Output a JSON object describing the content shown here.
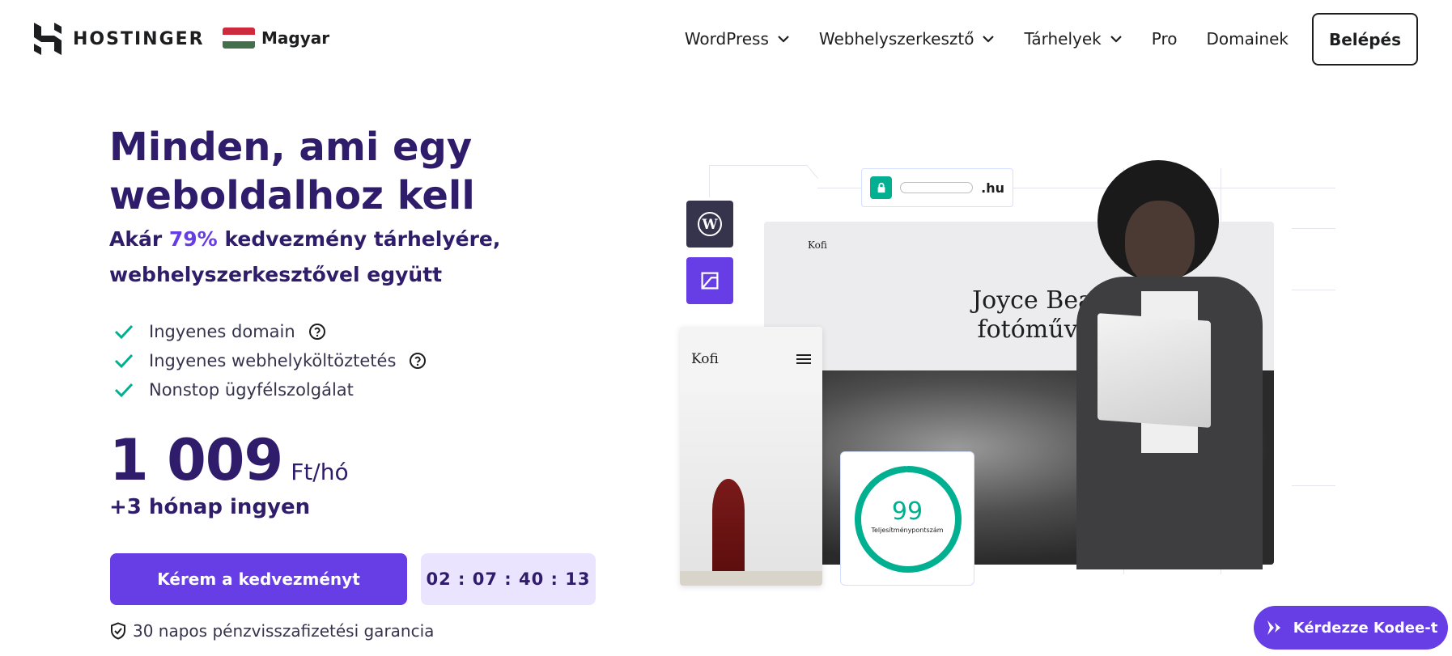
{
  "header": {
    "brand": "HOSTINGER",
    "language": "Magyar",
    "nav": [
      {
        "label": "WordPress",
        "has_dropdown": true
      },
      {
        "label": "Webhelyszerkesztő",
        "has_dropdown": true
      },
      {
        "label": "Tárhelyek",
        "has_dropdown": true
      },
      {
        "label": "Pro",
        "has_dropdown": false
      },
      {
        "label": "Domainek",
        "has_dropdown": false
      }
    ],
    "login_label": "Belépés"
  },
  "hero": {
    "title": "Minden, ami egy weboldalhoz kell",
    "subtitle_prefix": "Akár ",
    "subtitle_accent": "79%",
    "subtitle_line1_rest": " kedvezmény tárhelyére,",
    "subtitle_line2": "webhelyszerkesztővel együtt",
    "features": [
      {
        "label": "Ingyenes domain",
        "has_help": true
      },
      {
        "label": "Ingyenes webhelyköltöztetés",
        "has_help": true
      },
      {
        "label": "Nonstop ügyfélszolgálat",
        "has_help": false
      }
    ],
    "price_amount": "1 009",
    "price_unit": "Ft/hó",
    "bonus": "+3 hónap ingyen",
    "cta_label": "Kérem a kedvezményt",
    "timer": "02 : 07 : 40 : 13",
    "guarantee": "30 napos pénzvisszafizetési garancia"
  },
  "illustration": {
    "url_tld": ".hu",
    "site_logo": "Kofi",
    "site_title_line1": "Joyce Beale,",
    "site_title_line2": "fotóművész",
    "mobile_logo": "Kofi",
    "score_value": "99",
    "score_fraction": 0.99,
    "score_label": "Teljesítménypontszám"
  },
  "chat": {
    "label": "Kérdezze Kodee-t"
  },
  "colors": {
    "primary": "#673de6",
    "dark_purple": "#2f1c6a",
    "green": "#00b090",
    "timer_bg": "#ebe4ff"
  },
  "icons": {
    "logo": "hostinger-logo-icon",
    "flag": "hungary-flag-icon",
    "chevron": "chevron-down-icon",
    "check": "check-icon",
    "help": "help-circle-icon",
    "shield": "shield-check-icon",
    "lock": "lock-icon",
    "wordpress": "wordpress-icon",
    "builder": "website-builder-icon",
    "menu": "menu-icon",
    "chat": "kodee-ai-icon"
  }
}
